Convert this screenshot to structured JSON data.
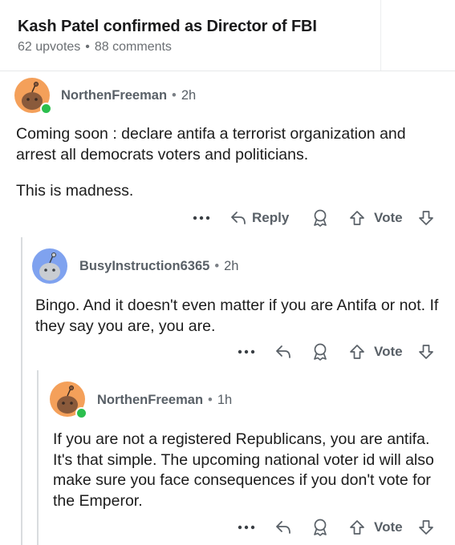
{
  "post": {
    "title": "Kash Patel confirmed as Director of FBI",
    "upvotes": "62 upvotes",
    "separator": "•",
    "comments": "88 comments"
  },
  "comments": [
    {
      "author": "NorthenFreeman",
      "time": "2h",
      "paragraphs": [
        "Coming soon :  declare antifa a terrorist organization and arrest all democrats voters and politicians.",
        "This is madness."
      ],
      "actions": {
        "more": "•••",
        "reply": "Reply",
        "vote": "Vote"
      },
      "avatar_color": "#f4a05a",
      "online": true
    },
    {
      "author": "BusyInstruction6365",
      "time": "2h",
      "paragraphs": [
        "Bingo. And it doesn't even matter if you are Antifa or not. If they say you are, you are."
      ],
      "actions": {
        "more": "•••",
        "vote": "Vote"
      },
      "avatar_color": "#7fa2ef",
      "online": false
    },
    {
      "author": "NorthenFreeman",
      "time": "1h",
      "paragraphs": [
        "If you are not a registered Republicans, you are antifa. It's that simple.  The upcoming national voter id will also make sure you face consequences if you don't vote for the Emperor."
      ],
      "actions": {
        "more": "•••",
        "vote": "Vote"
      },
      "avatar_color": "#f4a05a",
      "online": true
    }
  ],
  "colors": {
    "online": "#2bbf4e",
    "muted_text": "#596067",
    "thread_line": "#d9dcdf"
  },
  "icons": [
    "more-options-icon",
    "reply-arrow-icon",
    "award-icon",
    "upvote-arrow-icon",
    "downvote-arrow-icon",
    "snoo-avatar-icon"
  ]
}
